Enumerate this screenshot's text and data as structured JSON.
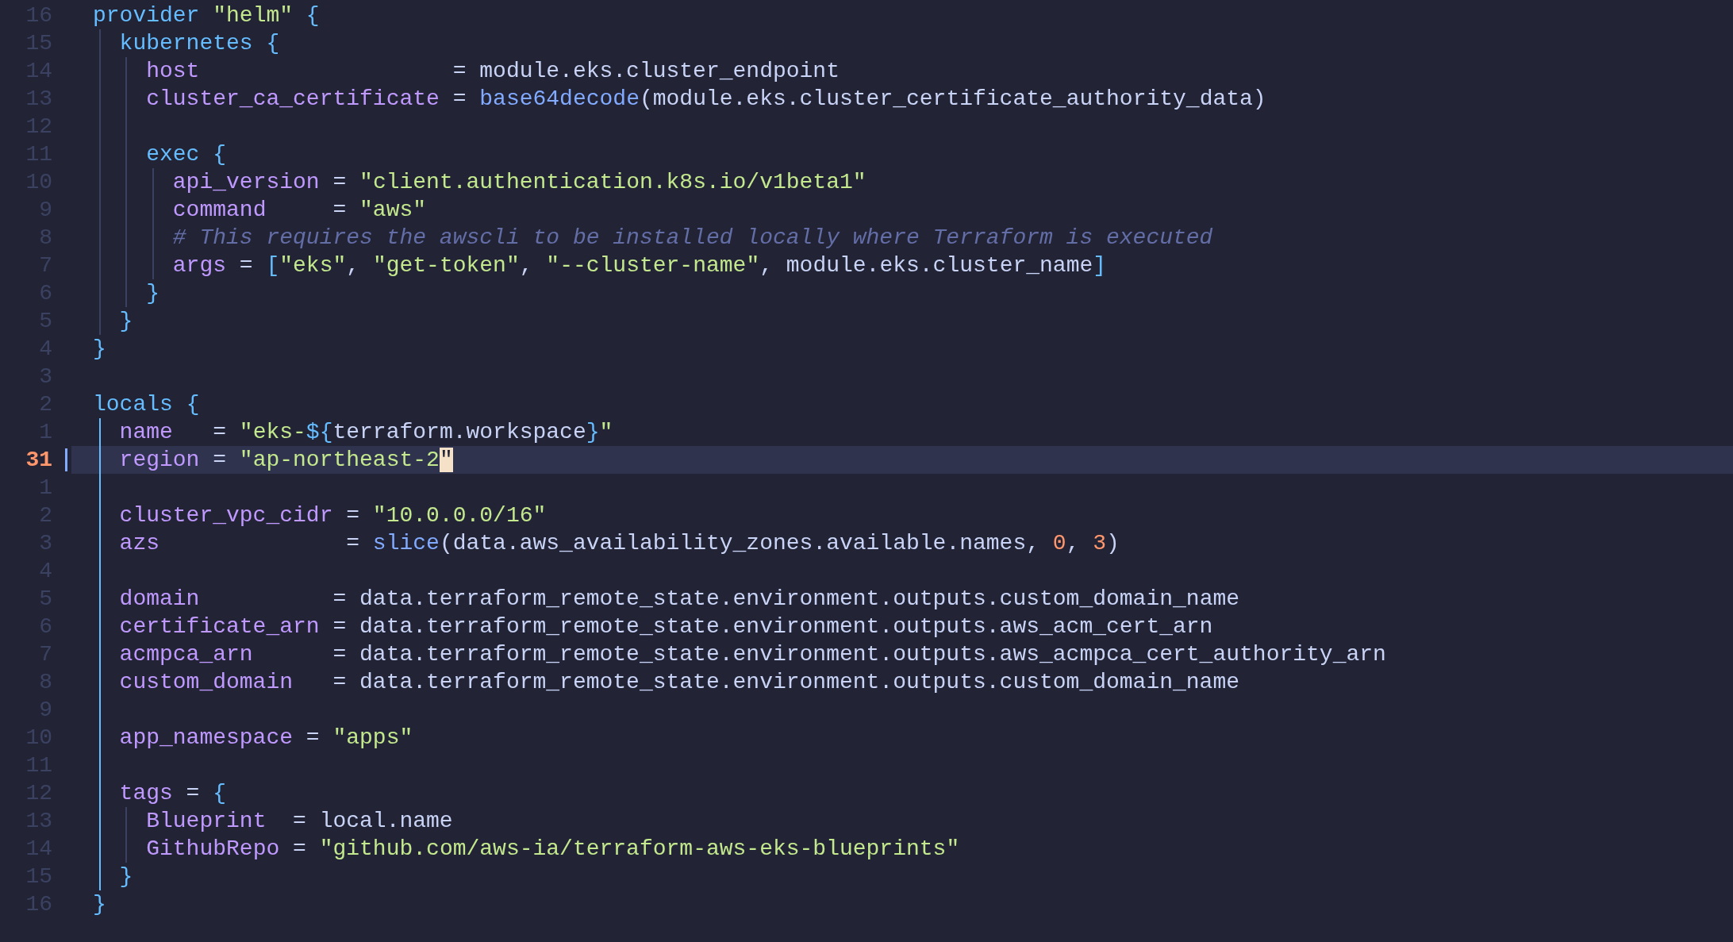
{
  "editor": {
    "lines": [
      {
        "kind": "line",
        "number": "16",
        "current": false,
        "tokens": [
          {
            "kind": "keyword",
            "text": "provider "
          },
          {
            "kind": "string",
            "text": "\"helm\""
          },
          {
            "kind": "brace",
            "text": " {"
          }
        ]
      },
      {
        "kind": "block",
        "active": false,
        "children": [
          {
            "kind": "line",
            "number": "15",
            "current": false,
            "tokens": [
              {
                "kind": "keyword",
                "text": "kubernetes"
              },
              {
                "kind": "brace",
                "text": " {"
              }
            ]
          },
          {
            "kind": "block",
            "active": false,
            "children": [
              {
                "kind": "line",
                "number": "14",
                "current": false,
                "tokens": [
                  {
                    "kind": "attr",
                    "text": "host"
                  },
                  {
                    "kind": "plain",
                    "text": "                   = module.eks.cluster_endpoint"
                  }
                ]
              },
              {
                "kind": "line",
                "number": "13",
                "current": false,
                "tokens": [
                  {
                    "kind": "attr",
                    "text": "cluster_ca_certificate"
                  },
                  {
                    "kind": "plain",
                    "text": " = "
                  },
                  {
                    "kind": "function",
                    "text": "base64decode"
                  },
                  {
                    "kind": "plain",
                    "text": "(module.eks.cluster_certificate_authority_data)"
                  }
                ]
              },
              {
                "kind": "line",
                "number": "12",
                "current": false
              },
              {
                "kind": "line",
                "number": "11",
                "current": false,
                "tokens": [
                  {
                    "kind": "keyword",
                    "text": "exec"
                  },
                  {
                    "kind": "brace",
                    "text": " {"
                  }
                ]
              },
              {
                "kind": "block",
                "active": false,
                "children": [
                  {
                    "kind": "line",
                    "number": "10",
                    "current": false,
                    "tokens": [
                      {
                        "kind": "attr",
                        "text": "api_version"
                      },
                      {
                        "kind": "plain",
                        "text": " = "
                      },
                      {
                        "kind": "string",
                        "text": "\"client.authentication.k8s.io/v1beta1\""
                      }
                    ]
                  },
                  {
                    "kind": "line",
                    "number": "9",
                    "current": false,
                    "tokens": [
                      {
                        "kind": "attr",
                        "text": "command"
                      },
                      {
                        "kind": "plain",
                        "text": "     = "
                      },
                      {
                        "kind": "string",
                        "text": "\"aws\""
                      }
                    ]
                  },
                  {
                    "kind": "line",
                    "number": "8",
                    "current": false,
                    "tokens": [
                      {
                        "kind": "comment",
                        "text": "# This requires the awscli to be installed locally where Terraform is executed"
                      }
                    ]
                  },
                  {
                    "kind": "line",
                    "number": "7",
                    "current": false,
                    "tokens": [
                      {
                        "kind": "attr",
                        "text": "args"
                      },
                      {
                        "kind": "plain",
                        "text": " = "
                      },
                      {
                        "kind": "brace",
                        "text": "["
                      },
                      {
                        "kind": "string",
                        "text": "\"eks\""
                      },
                      {
                        "kind": "plain",
                        "text": ", "
                      },
                      {
                        "kind": "string",
                        "text": "\"get-token\""
                      },
                      {
                        "kind": "plain",
                        "text": ", "
                      },
                      {
                        "kind": "string",
                        "text": "\"--cluster-name\""
                      },
                      {
                        "kind": "plain",
                        "text": ", module.eks.cluster_name"
                      },
                      {
                        "kind": "brace",
                        "text": "]"
                      }
                    ]
                  }
                ]
              },
              {
                "kind": "line",
                "number": "6",
                "current": false,
                "tokens": [
                  {
                    "kind": "brace",
                    "text": "}"
                  }
                ]
              }
            ]
          },
          {
            "kind": "line",
            "number": "5",
            "current": false,
            "tokens": [
              {
                "kind": "brace",
                "text": "}"
              }
            ]
          }
        ]
      },
      {
        "kind": "line",
        "number": "4",
        "current": false,
        "tokens": [
          {
            "kind": "brace",
            "text": "}"
          }
        ]
      },
      {
        "kind": "line",
        "number": "3",
        "current": false
      },
      {
        "kind": "line",
        "number": "2",
        "current": false,
        "tokens": [
          {
            "kind": "keyword",
            "text": "locals"
          },
          {
            "kind": "brace",
            "text": " {"
          }
        ]
      },
      {
        "kind": "block",
        "active": true,
        "children": [
          {
            "kind": "line",
            "number": "1",
            "current": false,
            "tokens": [
              {
                "kind": "attr",
                "text": "name"
              },
              {
                "kind": "plain",
                "text": "   = "
              },
              {
                "kind": "string",
                "text": "\"eks-"
              },
              {
                "kind": "brace",
                "text": "${"
              },
              {
                "kind": "plain",
                "text": "terraform.workspace"
              },
              {
                "kind": "brace",
                "text": "}"
              },
              {
                "kind": "string",
                "text": "\""
              }
            ]
          },
          {
            "kind": "line",
            "number": "31",
            "current": true,
            "tokens": [
              {
                "kind": "attr",
                "text": "region"
              },
              {
                "kind": "plain",
                "text": " = "
              },
              {
                "kind": "string",
                "text": "\"ap-northeast-2"
              },
              {
                "kind": "string",
                "text": "\"",
                "cursor": true
              }
            ]
          },
          {
            "kind": "line",
            "number": "1",
            "current": false
          },
          {
            "kind": "line",
            "number": "2",
            "current": false,
            "tokens": [
              {
                "kind": "attr",
                "text": "cluster_vpc_cidr"
              },
              {
                "kind": "plain",
                "text": " = "
              },
              {
                "kind": "string",
                "text": "\"10.0.0.0/16\""
              }
            ]
          },
          {
            "kind": "line",
            "number": "3",
            "current": false,
            "tokens": [
              {
                "kind": "attr",
                "text": "azs"
              },
              {
                "kind": "plain",
                "text": "              = "
              },
              {
                "kind": "function",
                "text": "slice"
              },
              {
                "kind": "plain",
                "text": "(data.aws_availability_zones.available.names, "
              },
              {
                "kind": "number",
                "text": "0"
              },
              {
                "kind": "plain",
                "text": ", "
              },
              {
                "kind": "number",
                "text": "3"
              },
              {
                "kind": "plain",
                "text": ")"
              }
            ]
          },
          {
            "kind": "line",
            "number": "4",
            "current": false
          },
          {
            "kind": "line",
            "number": "5",
            "current": false,
            "tokens": [
              {
                "kind": "attr",
                "text": "domain"
              },
              {
                "kind": "plain",
                "text": "          = data.terraform_remote_state.environment.outputs.custom_domain_name"
              }
            ]
          },
          {
            "kind": "line",
            "number": "6",
            "current": false,
            "tokens": [
              {
                "kind": "attr",
                "text": "certificate_arn"
              },
              {
                "kind": "plain",
                "text": " = data.terraform_remote_state.environment.outputs.aws_acm_cert_arn"
              }
            ]
          },
          {
            "kind": "line",
            "number": "7",
            "current": false,
            "tokens": [
              {
                "kind": "attr",
                "text": "acmpca_arn"
              },
              {
                "kind": "plain",
                "text": "      = data.terraform_remote_state.environment.outputs.aws_acmpca_cert_authority_arn"
              }
            ]
          },
          {
            "kind": "line",
            "number": "8",
            "current": false,
            "tokens": [
              {
                "kind": "attr",
                "text": "custom_domain"
              },
              {
                "kind": "plain",
                "text": "   = data.terraform_remote_state.environment.outputs.custom_domain_name"
              }
            ]
          },
          {
            "kind": "line",
            "number": "9",
            "current": false
          },
          {
            "kind": "line",
            "number": "10",
            "current": false,
            "tokens": [
              {
                "kind": "attr",
                "text": "app_namespace"
              },
              {
                "kind": "plain",
                "text": " = "
              },
              {
                "kind": "string",
                "text": "\"apps\""
              }
            ]
          },
          {
            "kind": "line",
            "number": "11",
            "current": false
          },
          {
            "kind": "line",
            "number": "12",
            "current": false,
            "tokens": [
              {
                "kind": "attr",
                "text": "tags"
              },
              {
                "kind": "plain",
                "text": " = "
              },
              {
                "kind": "brace",
                "text": "{"
              }
            ]
          },
          {
            "kind": "block",
            "active": false,
            "children": [
              {
                "kind": "line",
                "number": "13",
                "current": false,
                "tokens": [
                  {
                    "kind": "attr",
                    "text": "Blueprint"
                  },
                  {
                    "kind": "plain",
                    "text": "  = local.name"
                  }
                ]
              },
              {
                "kind": "line",
                "number": "14",
                "current": false,
                "tokens": [
                  {
                    "kind": "attr",
                    "text": "GithubRepo"
                  },
                  {
                    "kind": "plain",
                    "text": " = "
                  },
                  {
                    "kind": "string",
                    "text": "\"github.com/aws-ia/terraform-aws-eks-blueprints\""
                  }
                ]
              }
            ]
          },
          {
            "kind": "line",
            "number": "15",
            "current": false,
            "tokens": [
              {
                "kind": "brace",
                "text": "}"
              }
            ]
          }
        ]
      },
      {
        "kind": "line",
        "number": "16",
        "current": false,
        "tokens": [
          {
            "kind": "brace",
            "text": "}"
          }
        ]
      }
    ]
  }
}
